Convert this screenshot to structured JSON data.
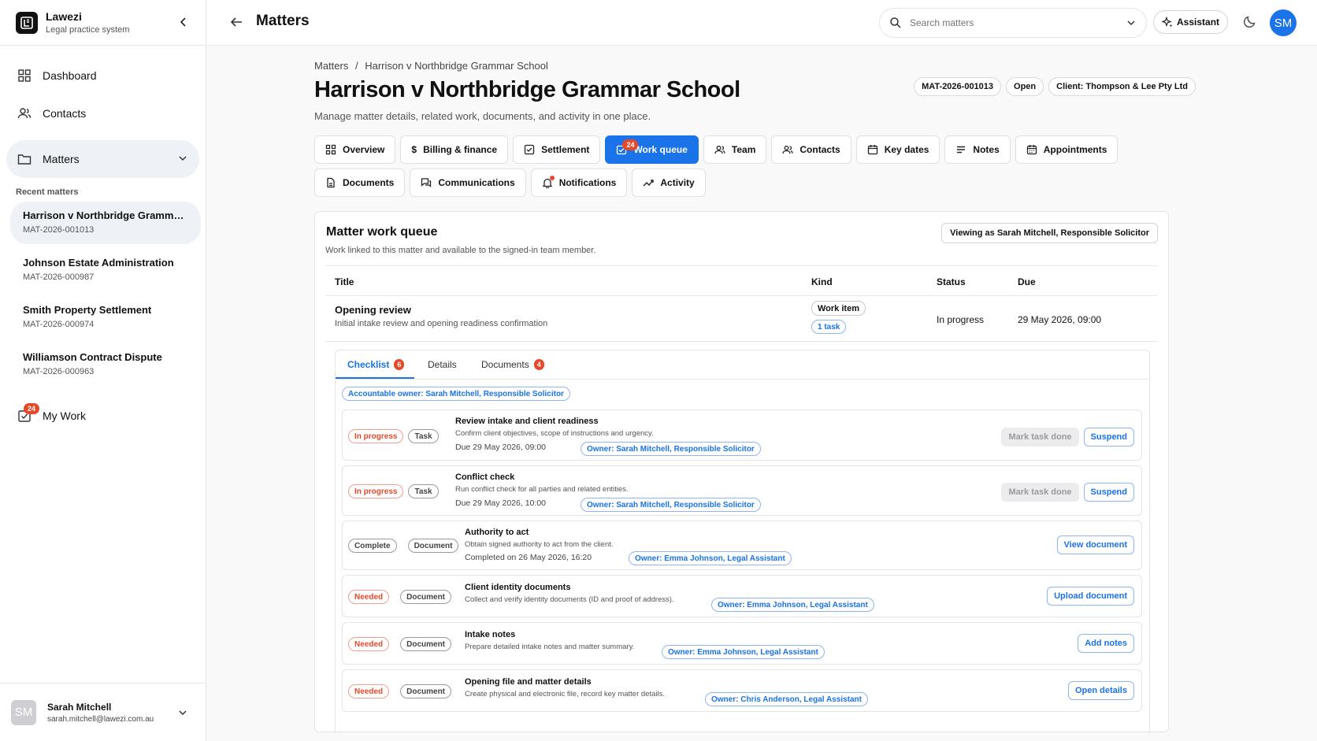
{
  "sidebar": {
    "brand_name": "Lawezi",
    "brand_sub": "Legal practice system",
    "nav": {
      "dashboard": "Dashboard",
      "contacts": "Contacts",
      "matters": "Matters",
      "my_work": "My Work"
    },
    "my_work_badge": "24",
    "recent_heading": "Recent matters",
    "recent": [
      {
        "title": "Harrison v Northbridge Grammar School",
        "code": "MAT-2026-001013"
      },
      {
        "title": "Johnson Estate Administration",
        "code": "MAT-2026-000987"
      },
      {
        "title": "Smith Property Settlement",
        "code": "MAT-2026-000974"
      },
      {
        "title": "Williamson Contract Dispute",
        "code": "MAT-2026-000963"
      }
    ],
    "user": {
      "initials": "SM",
      "name": "Sarah Mitchell",
      "email": "sarah.mitchell@lawezi.com.au"
    }
  },
  "topbar": {
    "title": "Matters",
    "search_placeholder": "Search matters",
    "assistant_label": "Assistant",
    "avatar_initials": "SM"
  },
  "matter": {
    "breadcrumb_root": "Matters",
    "breadcrumb_sep": "/",
    "breadcrumb_current": "Harrison v Northbridge Grammar School",
    "title": "Harrison v Northbridge Grammar School",
    "subtitle": "Manage matter details, related work, documents, and activity in one place.",
    "pills": {
      "code": "MAT-2026-001013",
      "status": "Open",
      "client": "Client: Thompson & Lee Pty Ltd"
    }
  },
  "tabs": {
    "overview": "Overview",
    "billing": "Billing & finance",
    "settlement": "Settlement",
    "work_queue": "Work queue",
    "work_queue_badge": "24",
    "team": "Team",
    "contacts": "Contacts",
    "key_dates": "Key dates",
    "notes": "Notes",
    "appointments": "Appointments",
    "documents": "Documents",
    "communications": "Communications",
    "notifications": "Notifications",
    "activity": "Activity"
  },
  "queue": {
    "title": "Matter work queue",
    "subtitle": "Work linked to this matter and available to the signed-in team member.",
    "viewing": "Viewing as Sarah Mitchell, Responsible Solicitor",
    "headers": {
      "title": "Title",
      "kind": "Kind",
      "status": "Status",
      "due": "Due"
    },
    "item": {
      "title": "Opening review",
      "desc": "Initial intake review and opening readiness confirmation",
      "kind": "Work item",
      "tasks": "1 task",
      "status": "In progress",
      "due": "29 May 2026, 09:00"
    },
    "inner_tabs": {
      "checklist": "Checklist",
      "checklist_badge": "6",
      "details": "Details",
      "documents": "Documents",
      "documents_badge": "4"
    },
    "accountable": "Accountable owner: Sarah Mitchell, Responsible Solicitor",
    "tasks": [
      {
        "status": "In progress",
        "type": "Task",
        "title": "Review intake and client readiness",
        "desc": "Confirm client objectives, scope of instructions and urgency.",
        "due": "Due 29 May 2026, 09:00",
        "owner": "Owner: Sarah Mitchell, Responsible Solicitor",
        "action1": "Mark task done",
        "action2": "Suspend"
      },
      {
        "status": "In progress",
        "type": "Task",
        "title": "Conflict check",
        "desc": "Run conflict check for all parties and related entities.",
        "due": "Due 29 May 2026, 10:00",
        "owner": "Owner: Sarah Mitchell, Responsible Solicitor",
        "action1": "Mark task done",
        "action2": "Suspend"
      },
      {
        "status": "Complete",
        "type": "Document",
        "title": "Authority to act",
        "desc": "Obtain signed authority to act from the client.",
        "due": "Completed on 26 May 2026, 16:20",
        "owner": "Owner: Emma Johnson, Legal Assistant",
        "action": "View document"
      },
      {
        "status": "Needed",
        "type": "Document",
        "title": "Client identity documents",
        "desc": "Collect and verify identity documents (ID and proof of address).",
        "owner": "Owner: Emma Johnson, Legal Assistant",
        "action": "Upload document"
      },
      {
        "status": "Needed",
        "type": "Document",
        "title": "Intake notes",
        "desc": "Prepare detailed intake notes and matter summary.",
        "owner": "Owner: Emma Johnson, Legal Assistant",
        "action": "Add notes"
      },
      {
        "status": "Needed",
        "type": "Document",
        "title": "Opening file and matter details",
        "desc": "Create physical and electronic file, record key matter details.",
        "owner": "Owner: Chris Anderson, Legal Assistant",
        "action": "Open details"
      }
    ]
  },
  "colors": {
    "accent": "#1a73e8",
    "badge": "#e5492a",
    "active_nav": "#eef1f6"
  }
}
